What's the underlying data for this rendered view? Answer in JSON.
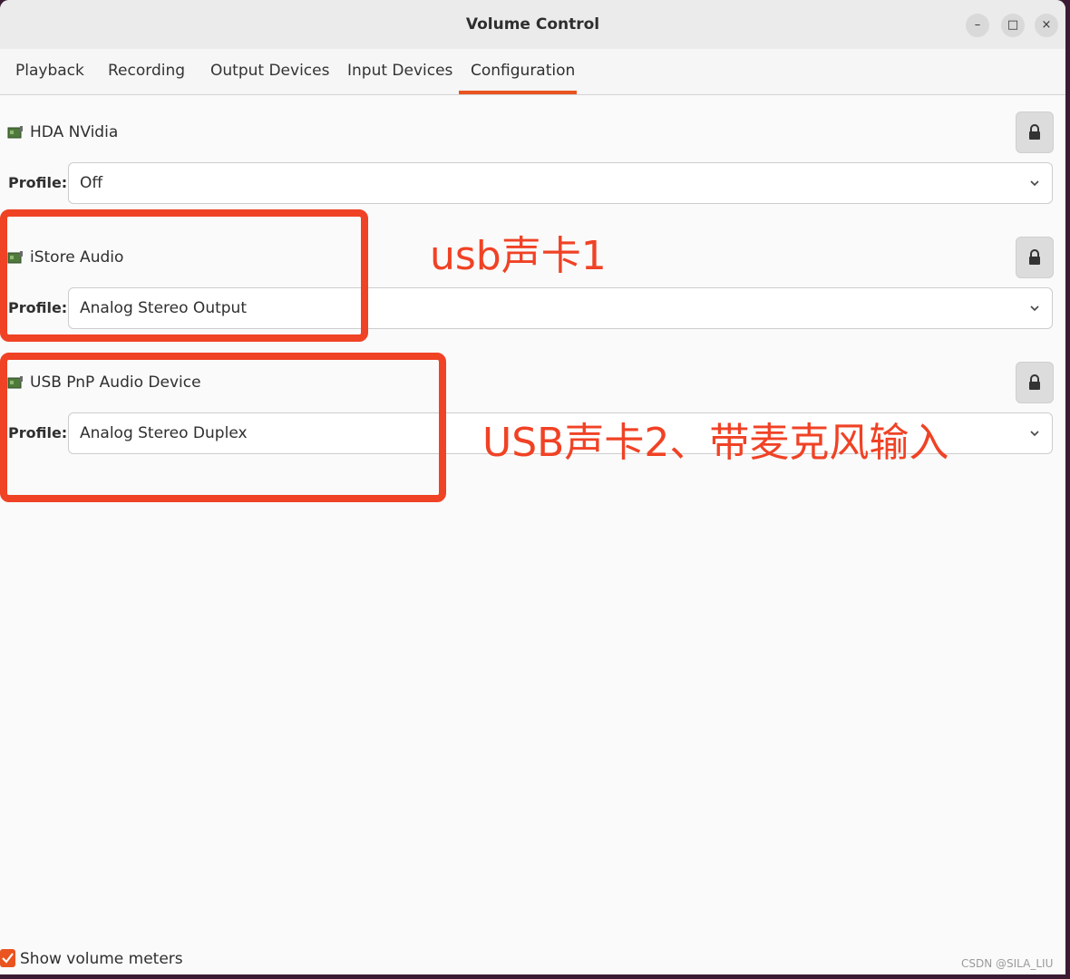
{
  "window": {
    "title": "Volume Control",
    "controls": {
      "minimize": "–",
      "maximize": "□",
      "close": "×"
    }
  },
  "tabs": [
    {
      "label": "Playback"
    },
    {
      "label": "Recording"
    },
    {
      "label": "Output Devices"
    },
    {
      "label": "Input Devices"
    },
    {
      "label": "Configuration",
      "active": true
    }
  ],
  "cards": [
    {
      "name": "HDA NVidia",
      "profile_label": "Profile:",
      "profile_value": "Off"
    },
    {
      "name": "iStore Audio",
      "profile_label": "Profile:",
      "profile_value": "Analog Stereo Output"
    },
    {
      "name": "USB PnP Audio Device",
      "profile_label": "Profile:",
      "profile_value": "Analog Stereo Duplex"
    }
  ],
  "annotations": {
    "card1_note": "usb声卡1",
    "card2_note": "USB声卡2、带麦克风输入",
    "color": "#f04225"
  },
  "footer": {
    "show_volume_meters_label": "Show volume meters",
    "show_volume_meters_checked": true
  },
  "watermark": "CSDN @SILA_LIU",
  "colors": {
    "accent": "#e95420",
    "background": "#fafafa",
    "desktop": "#3b1b33"
  },
  "icons": {
    "card_icon": "sound-card-icon",
    "lock_icon": "lock-icon",
    "dropdown_icon": "chevron-down-icon",
    "check_icon": "checkmark-icon"
  }
}
